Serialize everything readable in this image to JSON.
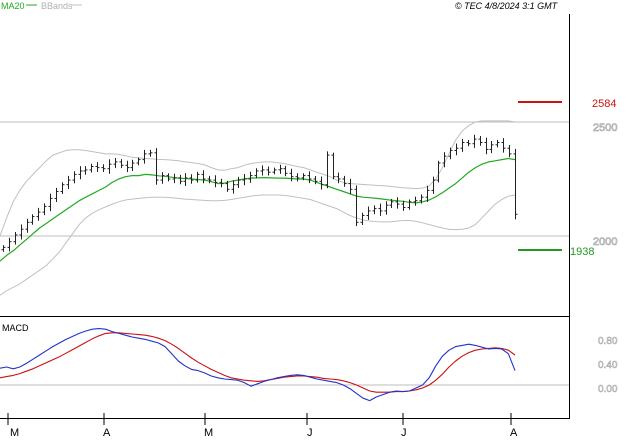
{
  "header": {
    "ma_label": "MA20",
    "bb_label": "BBands",
    "copyright": "© TEC 4/8/2024 3:1 GMT"
  },
  "colors": {
    "ma": "#22aa22",
    "bbands": "#c0c0c0",
    "bars": "#222222",
    "resistance": "#cc1111",
    "support": "#229922",
    "macd": "#2233cc",
    "signal": "#cc1111",
    "axis": "#000000",
    "grid": "#bdbdbd",
    "pane_bg": "#ffffff"
  },
  "chart_data": [
    {
      "type": "ohlc",
      "series": [
        {
          "name": "MA20"
        },
        {
          "name": "BBands"
        }
      ],
      "price_ylim": [
        1700,
        2800
      ],
      "y_tick_labels": [
        "2500",
        "2000"
      ],
      "y_ticks": [
        2500,
        2000
      ],
      "resistance": {
        "label": "2584",
        "value": 2584
      },
      "support": {
        "label": "1938",
        "value": 1938
      },
      "x_tick_labels": [
        "M",
        "A",
        "M",
        "J",
        "J",
        "A"
      ],
      "close": [
        1950,
        1975,
        2005,
        2030,
        2060,
        2085,
        2105,
        2130,
        2165,
        2195,
        2225,
        2245,
        2270,
        2285,
        2290,
        2305,
        2300,
        2295,
        2315,
        2325,
        2310,
        2300,
        2320,
        2335,
        2360,
        2365,
        2245,
        2265,
        2250,
        2255,
        2240,
        2255,
        2245,
        2270,
        2250,
        2245,
        2235,
        2230,
        2205,
        2225,
        2245,
        2250,
        2265,
        2285,
        2290,
        2280,
        2290,
        2295,
        2275,
        2260,
        2255,
        2265,
        2250,
        2240,
        2225,
        2355,
        2260,
        2250,
        2230,
        2205,
        2060,
        2090,
        2110,
        2120,
        2110,
        2135,
        2150,
        2140,
        2125,
        2150,
        2155,
        2170,
        2200,
        2245,
        2320,
        2350,
        2375,
        2385,
        2410,
        2405,
        2425,
        2410,
        2380,
        2400,
        2410,
        2385,
        2360,
        2095
      ],
      "ma20": [
        1890,
        1915,
        1935,
        1960,
        1985,
        2010,
        2035,
        2055,
        2075,
        2095,
        2115,
        2135,
        2155,
        2170,
        2185,
        2200,
        2215,
        2235,
        2250,
        2260,
        2265,
        2265,
        2270,
        2268,
        2264,
        2262,
        2258,
        2254,
        2252,
        2250,
        2248,
        2245,
        2238,
        2230,
        2232,
        2240,
        2245,
        2250,
        2254,
        2255,
        2256,
        2255,
        2254,
        2254,
        2252,
        2250,
        2250,
        2245,
        2235,
        2225,
        2215,
        2205,
        2195,
        2185,
        2175,
        2170,
        2168,
        2165,
        2162,
        2158,
        2155,
        2152,
        2148,
        2145,
        2150,
        2158,
        2172,
        2190,
        2210,
        2230,
        2255,
        2280,
        2300,
        2315,
        2325,
        2330,
        2335,
        2340,
        2335
      ],
      "bb_upper": [
        2000,
        2080,
        2150,
        2200,
        2240,
        2270,
        2300,
        2330,
        2355,
        2365,
        2375,
        2378,
        2378,
        2375,
        2370,
        2365,
        2360,
        2360,
        2358,
        2352,
        2345,
        2342,
        2340,
        2338,
        2336,
        2335,
        2333,
        2330,
        2326,
        2322,
        2318,
        2312,
        2300,
        2290,
        2288,
        2295,
        2300,
        2310,
        2318,
        2322,
        2325,
        2325,
        2322,
        2318,
        2312,
        2305,
        2300,
        2290,
        2280,
        2270,
        2260,
        2245,
        2235,
        2230,
        2228,
        2226,
        2224,
        2222,
        2220,
        2218,
        2215,
        2212,
        2210,
        2208,
        2210,
        2220,
        2250,
        2300,
        2360,
        2420,
        2460,
        2485,
        2500,
        2505,
        2505,
        2505,
        2505,
        2505,
        2500
      ],
      "bb_lower": [
        1740,
        1760,
        1775,
        1790,
        1810,
        1830,
        1850,
        1870,
        1900,
        1930,
        1970,
        2010,
        2050,
        2080,
        2100,
        2115,
        2128,
        2140,
        2150,
        2158,
        2162,
        2165,
        2168,
        2170,
        2170,
        2170,
        2168,
        2165,
        2162,
        2160,
        2158,
        2156,
        2155,
        2155,
        2156,
        2160,
        2165,
        2170,
        2175,
        2178,
        2180,
        2180,
        2180,
        2178,
        2175,
        2170,
        2165,
        2160,
        2150,
        2140,
        2130,
        2120,
        2105,
        2090,
        2080,
        2070,
        2066,
        2063,
        2062,
        2062,
        2065,
        2068,
        2068,
        2064,
        2058,
        2050,
        2042,
        2035,
        2030,
        2028,
        2030,
        2035,
        2050,
        2080,
        2110,
        2140,
        2160,
        2175,
        2180
      ]
    },
    {
      "type": "line",
      "title": "MACD",
      "ylim": [
        -0.35,
        1.05
      ],
      "y_tick_labels": [
        "0.80",
        "0.40",
        "0.00"
      ],
      "y_ticks": [
        0.8,
        0.4,
        0.0
      ],
      "series": [
        {
          "values": [
            0.28,
            0.3,
            0.27,
            0.3,
            0.36,
            0.43,
            0.5,
            0.57,
            0.64,
            0.7,
            0.76,
            0.81,
            0.86,
            0.9,
            0.93,
            0.94,
            0.93,
            0.89,
            0.86,
            0.83,
            0.8,
            0.78,
            0.76,
            0.73,
            0.7,
            0.64,
            0.52,
            0.4,
            0.32,
            0.26,
            0.24,
            0.2,
            0.15,
            0.12,
            0.1,
            0.09,
            0.08,
            0.04,
            -0.02,
            0.02,
            0.06,
            0.09,
            0.12,
            0.14,
            0.16,
            0.17,
            0.16,
            0.13,
            0.1,
            0.08,
            0.06,
            0.04,
            0.0,
            -0.06,
            -0.14,
            -0.22,
            -0.26,
            -0.2,
            -0.16,
            -0.12,
            -0.1,
            -0.11,
            -0.1,
            -0.05,
            0.0,
            0.12,
            0.32,
            0.48,
            0.58,
            0.64,
            0.66,
            0.68,
            0.66,
            0.63,
            0.6,
            0.61,
            0.6,
            0.52,
            0.24
          ]
        },
        {
          "values": [
            0.12,
            0.14,
            0.16,
            0.19,
            0.23,
            0.27,
            0.32,
            0.37,
            0.42,
            0.47,
            0.53,
            0.59,
            0.65,
            0.71,
            0.77,
            0.82,
            0.86,
            0.87,
            0.87,
            0.86,
            0.85,
            0.84,
            0.83,
            0.81,
            0.78,
            0.74,
            0.68,
            0.61,
            0.53,
            0.45,
            0.38,
            0.32,
            0.26,
            0.21,
            0.16,
            0.12,
            0.1,
            0.08,
            0.07,
            0.06,
            0.07,
            0.09,
            0.11,
            0.13,
            0.14,
            0.15,
            0.15,
            0.14,
            0.13,
            0.11,
            0.1,
            0.09,
            0.07,
            0.04,
            0.0,
            -0.05,
            -0.1,
            -0.12,
            -0.12,
            -0.12,
            -0.11,
            -0.11,
            -0.1,
            -0.08,
            -0.05,
            0.0,
            0.08,
            0.18,
            0.3,
            0.4,
            0.48,
            0.54,
            0.58,
            0.6,
            0.61,
            0.62,
            0.61,
            0.58,
            0.5
          ]
        }
      ]
    }
  ]
}
